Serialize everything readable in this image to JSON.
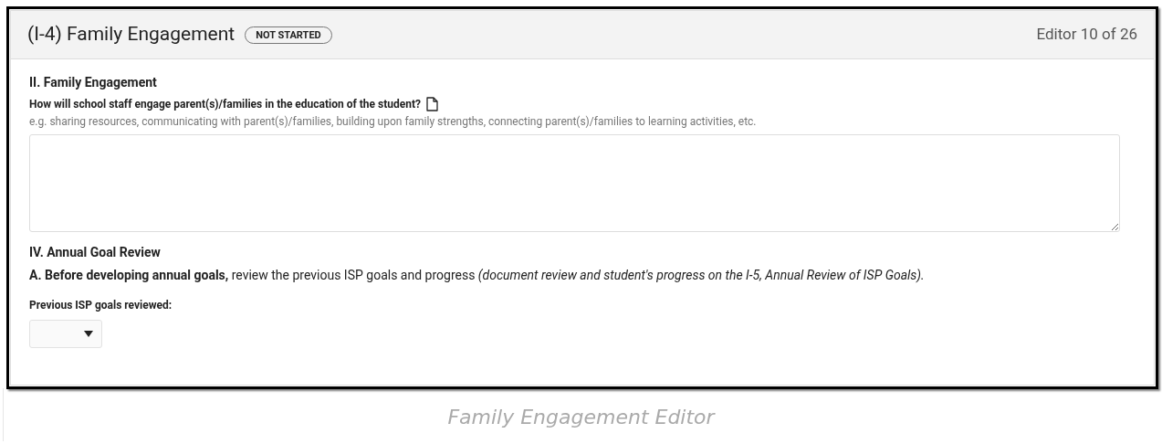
{
  "header": {
    "title": "(I-4) Family Engagement",
    "status": "NOT STARTED",
    "counter": "Editor 10 of 26"
  },
  "sections": [
    {
      "kind": "textarea",
      "heading": "II. Family Engagement",
      "label": "How will school staff engage parent(s)/families in the education of the student?",
      "hint": "e.g. sharing resources, communicating with parent(s)/families, building upon family strengths, connecting parent(s)/families to learning activities, etc."
    },
    {
      "kind": "select",
      "heading": "IV. Annual Goal Review",
      "instruction": "**A. Before developing annual goals,** review the previous ISP goals and progress *(document review and student's progress on the I-5, Annual Review of ISP Goals).*",
      "label": "Previous ISP goals reviewed:"
    }
  ],
  "caption": "Family Engagement Editor"
}
